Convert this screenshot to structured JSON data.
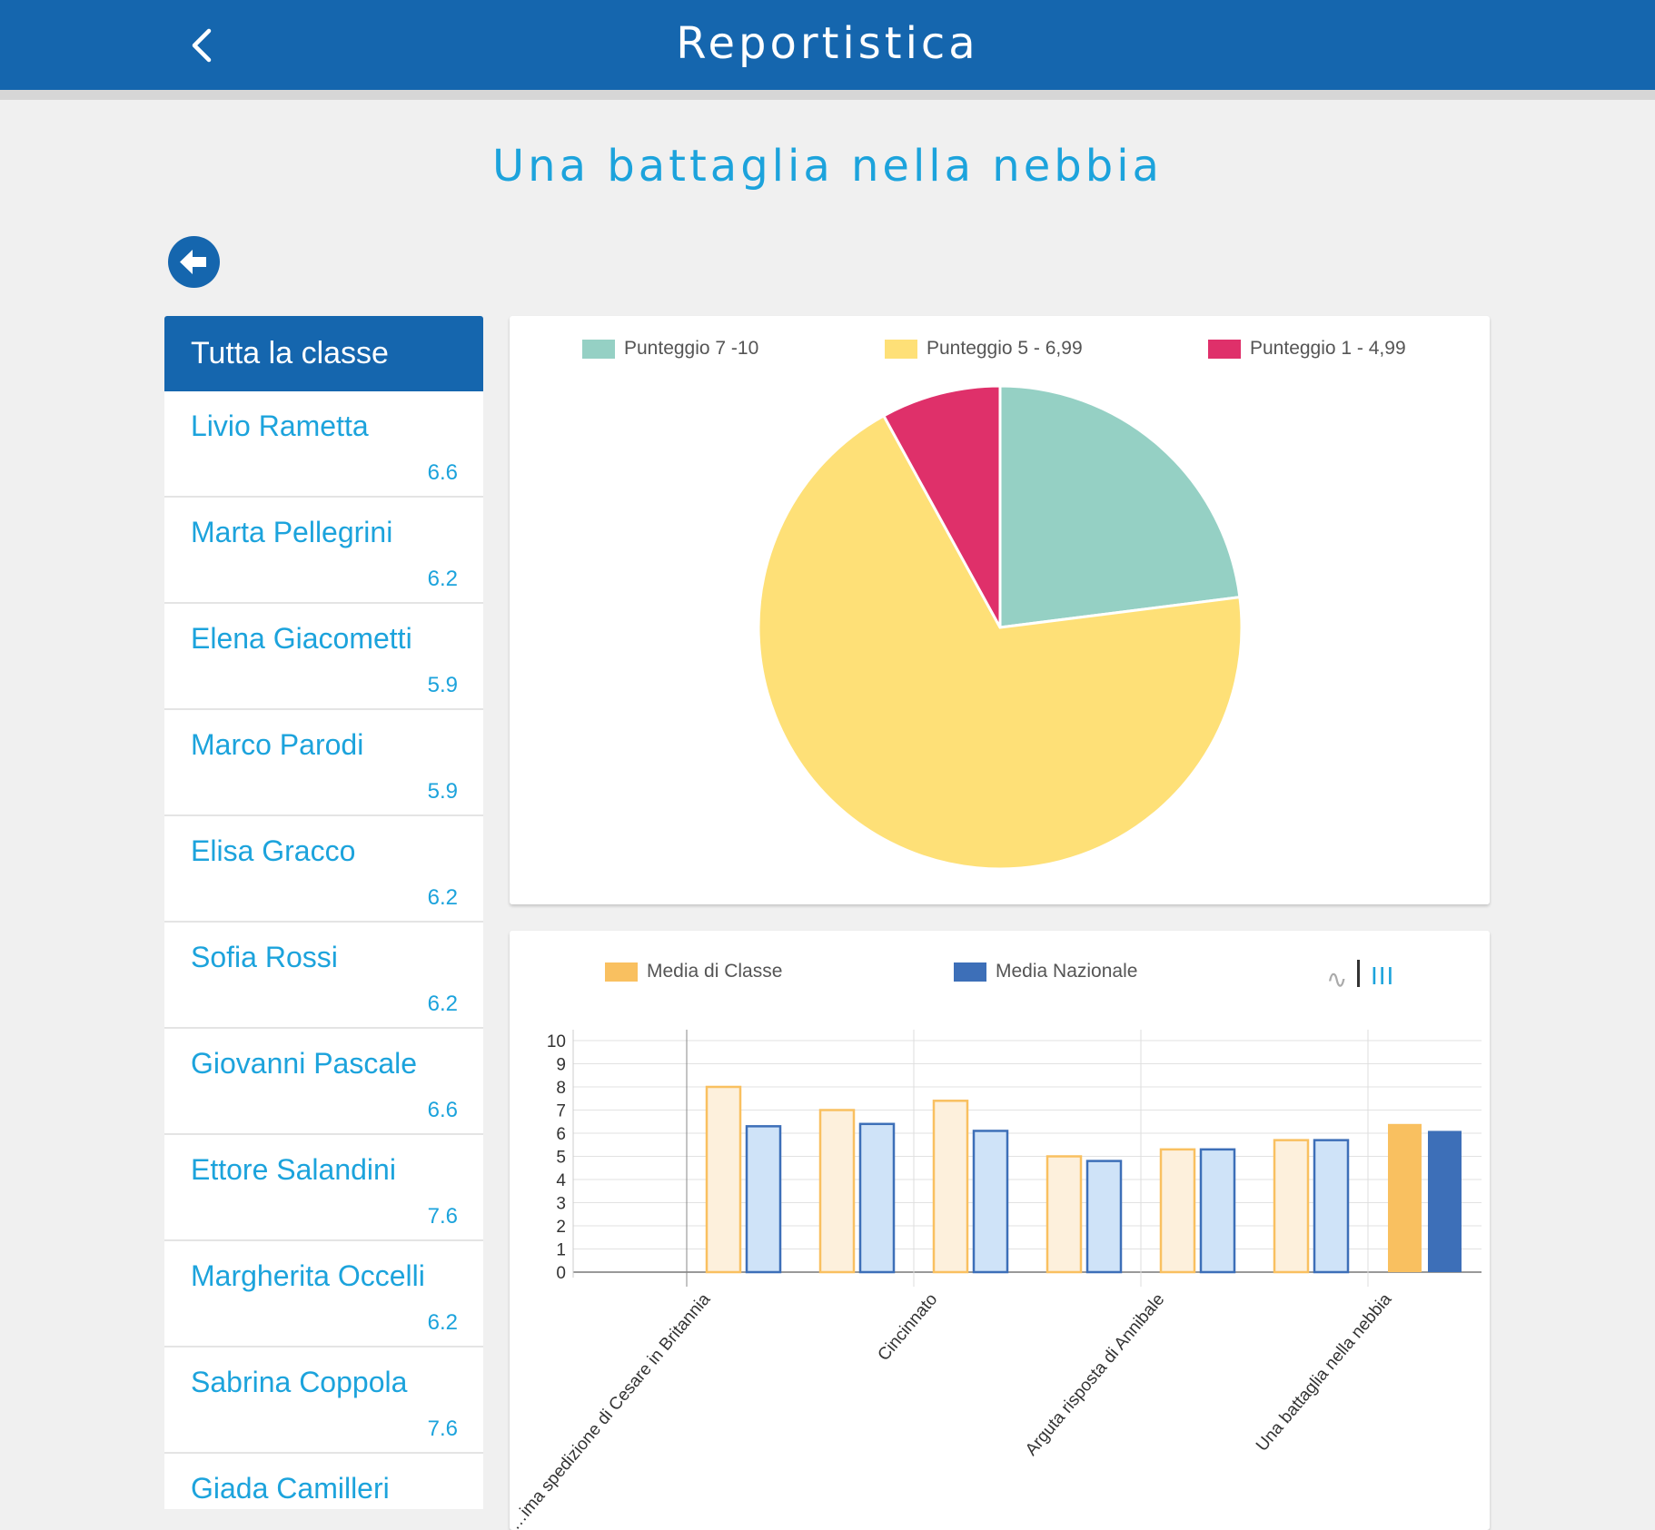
{
  "header": {
    "title": "Reportistica",
    "back_icon": "chevron-left-icon"
  },
  "page": {
    "title": "Una battaglia nella nebbia",
    "back_button_icon": "arrow-left-icon"
  },
  "sidebar": {
    "header": "Tutta la classe",
    "students": [
      {
        "name": "Livio Rametta",
        "score": "6.6"
      },
      {
        "name": "Marta Pellegrini",
        "score": "6.2"
      },
      {
        "name": "Elena Giacometti",
        "score": "5.9"
      },
      {
        "name": "Marco Parodi",
        "score": "5.9"
      },
      {
        "name": "Elisa Gracco",
        "score": "6.2"
      },
      {
        "name": "Sofia Rossi",
        "score": "6.2"
      },
      {
        "name": "Giovanni Pascale",
        "score": "6.6"
      },
      {
        "name": "Ettore Salandini",
        "score": "7.6"
      },
      {
        "name": "Margherita Occelli",
        "score": "6.2"
      },
      {
        "name": "Sabrina Coppola",
        "score": "7.6"
      },
      {
        "name": "Giada Camilleri",
        "score": ""
      }
    ]
  },
  "colors": {
    "header_blue": "#1566ae",
    "accent_blue": "#1ca3dc",
    "pie_high": "#95d0c4",
    "pie_mid": "#fee077",
    "pie_low": "#df306a",
    "bar_class": "#f9c060",
    "bar_national": "#3d6fb8"
  },
  "chart_data": [
    {
      "type": "pie",
      "legend_position": "top",
      "series": [
        {
          "name": "Punteggio 7 -10",
          "value": 23,
          "color": "#95d0c4"
        },
        {
          "name": "Punteggio 5 - 6,99",
          "value": 69,
          "color": "#fee077"
        },
        {
          "name": "Punteggio 1 - 4,99",
          "value": 8,
          "color": "#df306a"
        }
      ]
    },
    {
      "type": "bar",
      "legend_position": "top",
      "toggles": {
        "curve": "∿",
        "bars": "III"
      },
      "categories": [
        "",
        "Prima spedizione di Cesare in Britannia",
        "",
        "Cincinnato",
        "",
        "Arguta risposta di Annibale",
        "",
        "Una battaglia nella nebbia"
      ],
      "x_tick_labels": [
        "",
        "…ima spedizione di Cesare in Britannia",
        "",
        "Cincinnato",
        "",
        "Arguta risposta di Annibale",
        "",
        "Una battaglia nella nebbia"
      ],
      "ylim": [
        0,
        10
      ],
      "y_ticks": [
        "0",
        "1",
        "2",
        "3",
        "4",
        "5",
        "6",
        "7",
        "8",
        "9",
        "10"
      ],
      "grid": true,
      "series": [
        {
          "name": "Media di Classe",
          "color": "#f9c060",
          "values": [
            null,
            8.0,
            7.0,
            7.4,
            5.0,
            5.3,
            5.7,
            6.4
          ]
        },
        {
          "name": "Media Nazionale",
          "color": "#3d6fb8",
          "values": [
            null,
            6.3,
            6.4,
            6.1,
            4.8,
            5.3,
            5.7,
            6.1
          ]
        }
      ],
      "highlighted_category": "Una battaglia nella nebbia"
    }
  ]
}
